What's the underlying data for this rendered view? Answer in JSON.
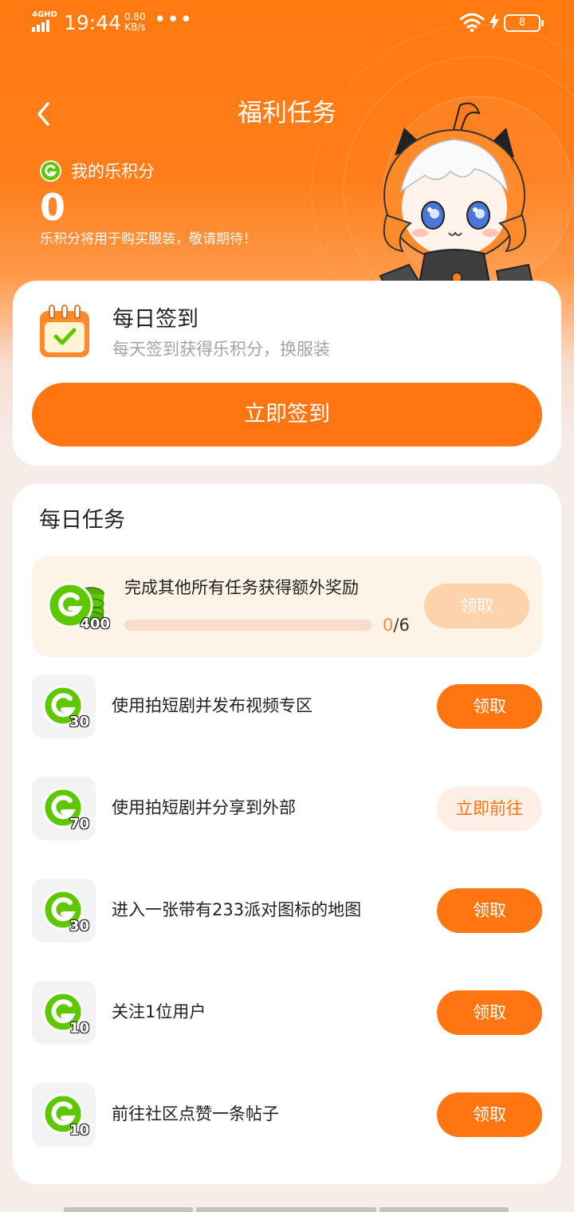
{
  "status_bar": {
    "network": "4GHD",
    "time": "19:44",
    "speed_value": "0.80",
    "speed_unit": "KB/s",
    "more": "•••",
    "battery": "8"
  },
  "header": {
    "back_icon": "chevron-left-icon",
    "title": "福利任务"
  },
  "points": {
    "label": "我的乐积分",
    "value": "0",
    "note": "乐积分将用于购买服装，敬请期待！"
  },
  "checkin": {
    "title": "每日签到",
    "subtitle": "每天签到获得乐积分，换服装",
    "button": "立即签到"
  },
  "daily_tasks": {
    "title": "每日任务",
    "bonus": {
      "coin_amount": "400",
      "text": "完成其他所有任务获得额外奖励",
      "done": "0",
      "separator": "/",
      "total": "6",
      "progress": 0,
      "button": "领取"
    },
    "items": [
      {
        "coin_amount": "30",
        "label": "使用拍短剧并发布视频专区",
        "button": "领取",
        "state": "claim"
      },
      {
        "coin_amount": "70",
        "label": "使用拍短剧并分享到外部",
        "button": "立即前往",
        "state": "go"
      },
      {
        "coin_amount": "30",
        "label": "进入一张带有233派对图标的地图",
        "button": "领取",
        "state": "claim"
      },
      {
        "coin_amount": "10",
        "label": "关注1位用户",
        "button": "领取",
        "state": "claim"
      },
      {
        "coin_amount": "10",
        "label": "前往社区点赞一条帖子",
        "button": "领取",
        "state": "claim"
      }
    ]
  },
  "colors": {
    "brand_orange": "#ff7512",
    "coin_green": "#5dc800",
    "disabled_orange": "#fcd3ac",
    "go_bg": "#fdeee6"
  }
}
